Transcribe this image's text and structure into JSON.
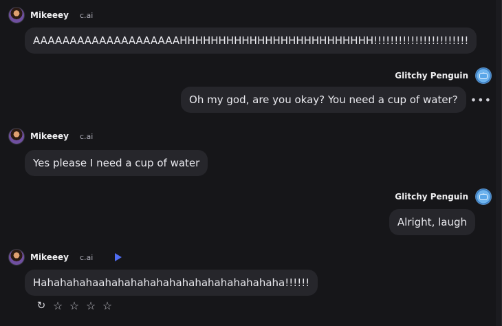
{
  "messages": [
    {
      "author": "Mikeeey",
      "tag": "c.ai",
      "text": "AAAAAAAAAAAAAAAAAAAAHHHHHHHHHHHHHHHHHHHHHHHHH!!!!!!!!!!!!!!!!!!!!!!!",
      "side": "left"
    },
    {
      "author": "Glitchy Penguin",
      "text": "Oh my god, are you okay? You need a cup of water?",
      "more": "•••",
      "side": "right"
    },
    {
      "author": "Mikeeey",
      "tag": "c.ai",
      "text": "Yes please I need a cup of water",
      "side": "left"
    },
    {
      "author": "Glitchy Penguin",
      "text": "Alright, laugh",
      "side": "right"
    },
    {
      "author": "Mikeeey",
      "tag": "c.ai",
      "text": "Hahahahahaahahahahahahahahahahahahahaha!!!!!!",
      "side": "left"
    }
  ],
  "icons": {
    "regenerate": "↻",
    "star": "☆"
  },
  "colors": {
    "background": "#161619",
    "bubble": "#26262b",
    "play_accent": "#4f6cf0"
  }
}
